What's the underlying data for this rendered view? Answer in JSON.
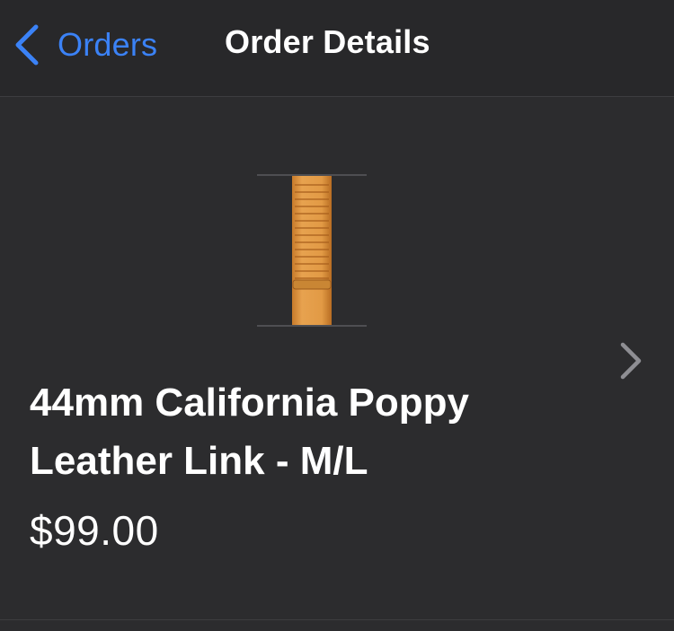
{
  "nav": {
    "back_label": "Orders",
    "title": "Order Details",
    "back_icon": "chevron-left-icon",
    "accent_color": "#3b82f6"
  },
  "order_item": {
    "product_name": "44mm California Poppy Leather Link - M/L",
    "price": "$99.00",
    "image_icon": "watch-band-image",
    "disclosure_icon": "chevron-right-icon",
    "band_color": "#d98f3a"
  }
}
